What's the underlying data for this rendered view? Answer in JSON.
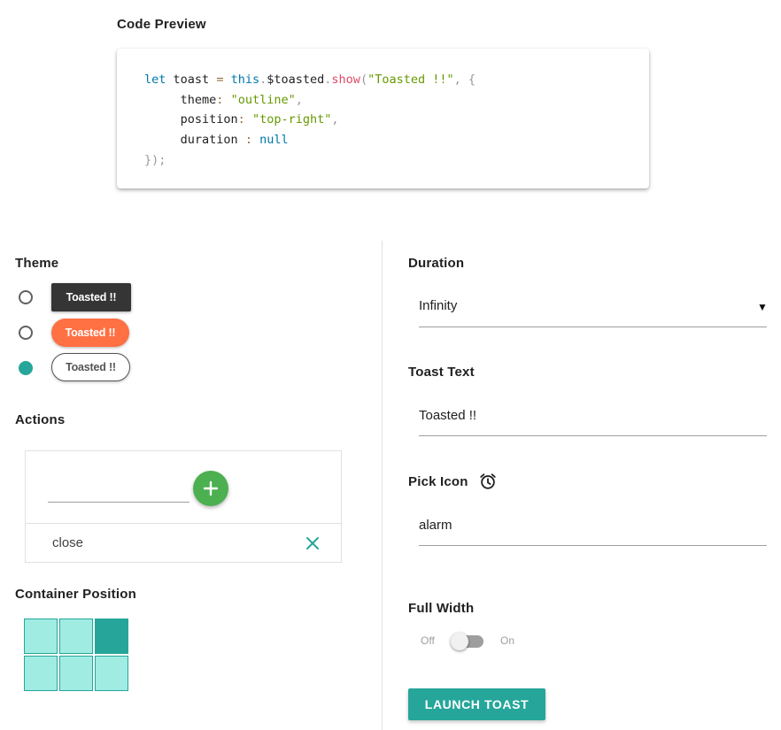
{
  "code_preview": {
    "title": "Code Preview",
    "line1": {
      "kw_let": "let",
      "var": "toast",
      "eq": "=",
      "kw_this": "this",
      "dot1": ".",
      "obj": "$toasted",
      "dot2": ".",
      "fn": "show",
      "paren_open": "(",
      "arg": "\"Toasted !!\"",
      "comma": ",",
      "brace": "{"
    },
    "line2": {
      "key": "theme",
      "colon": ":",
      "value": "\"outline\"",
      "comma": ","
    },
    "line3": {
      "key": "position",
      "colon": ":",
      "value": "\"top-right\"",
      "comma": ","
    },
    "line4": {
      "key": "duration",
      "colon": ":",
      "value": "null"
    },
    "line5": "});"
  },
  "theme": {
    "title": "Theme",
    "options": [
      {
        "label": "Toasted !!",
        "style": "primary",
        "selected": false
      },
      {
        "label": "Toasted !!",
        "style": "bubble",
        "selected": false
      },
      {
        "label": "Toasted !!",
        "style": "outline",
        "selected": true
      }
    ]
  },
  "actions": {
    "title": "Actions",
    "new_action_value": "",
    "add_icon": "plus-icon",
    "items": [
      {
        "label": "close",
        "remove_icon": "close-icon"
      }
    ]
  },
  "container_position": {
    "title": "Container Position",
    "selected": "top-right",
    "cells": [
      "top-left",
      "top-center",
      "top-right",
      "bottom-left",
      "bottom-center",
      "bottom-right"
    ]
  },
  "duration": {
    "title": "Duration",
    "selected": "Infinity",
    "arrow": "▼"
  },
  "toast_text": {
    "title": "Toast Text",
    "value": "Toasted !!"
  },
  "pick_icon": {
    "title": "Pick Icon",
    "value": "alarm",
    "preview_icon": "alarm-icon"
  },
  "full_width": {
    "title": "Full Width",
    "off_label": "Off",
    "on_label": "On",
    "enabled": false
  },
  "launch_button": {
    "label": "LAUNCH TOAST"
  },
  "colors": {
    "accent": "#26a69a",
    "fab": "#4caf50",
    "bubble": "#ff7043",
    "primary_toast": "#353535",
    "grid_cell": "#a0ece3"
  }
}
